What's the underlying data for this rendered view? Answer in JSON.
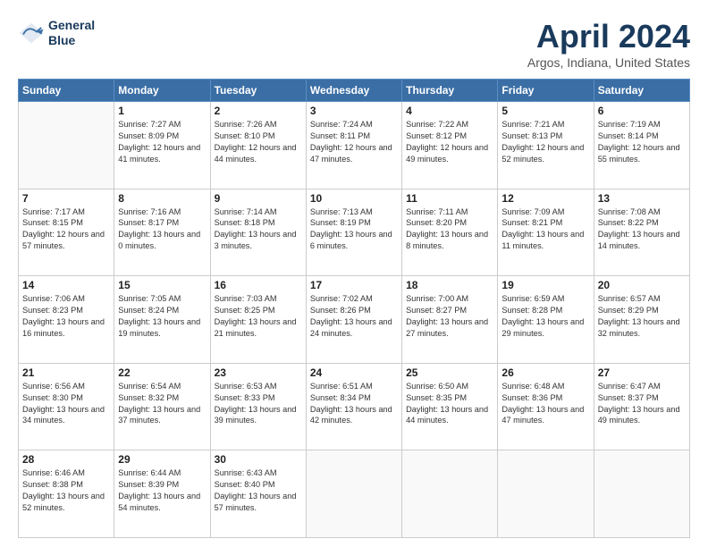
{
  "logo": {
    "line1": "General",
    "line2": "Blue"
  },
  "title": "April 2024",
  "subtitle": "Argos, Indiana, United States",
  "days_of_week": [
    "Sunday",
    "Monday",
    "Tuesday",
    "Wednesday",
    "Thursday",
    "Friday",
    "Saturday"
  ],
  "weeks": [
    [
      null,
      {
        "day": 1,
        "sunrise": "7:27 AM",
        "sunset": "8:09 PM",
        "daylight": "12 hours and 41 minutes."
      },
      {
        "day": 2,
        "sunrise": "7:26 AM",
        "sunset": "8:10 PM",
        "daylight": "12 hours and 44 minutes."
      },
      {
        "day": 3,
        "sunrise": "7:24 AM",
        "sunset": "8:11 PM",
        "daylight": "12 hours and 47 minutes."
      },
      {
        "day": 4,
        "sunrise": "7:22 AM",
        "sunset": "8:12 PM",
        "daylight": "12 hours and 49 minutes."
      },
      {
        "day": 5,
        "sunrise": "7:21 AM",
        "sunset": "8:13 PM",
        "daylight": "12 hours and 52 minutes."
      },
      {
        "day": 6,
        "sunrise": "7:19 AM",
        "sunset": "8:14 PM",
        "daylight": "12 hours and 55 minutes."
      }
    ],
    [
      {
        "day": 7,
        "sunrise": "7:17 AM",
        "sunset": "8:15 PM",
        "daylight": "12 hours and 57 minutes."
      },
      {
        "day": 8,
        "sunrise": "7:16 AM",
        "sunset": "8:17 PM",
        "daylight": "13 hours and 0 minutes."
      },
      {
        "day": 9,
        "sunrise": "7:14 AM",
        "sunset": "8:18 PM",
        "daylight": "13 hours and 3 minutes."
      },
      {
        "day": 10,
        "sunrise": "7:13 AM",
        "sunset": "8:19 PM",
        "daylight": "13 hours and 6 minutes."
      },
      {
        "day": 11,
        "sunrise": "7:11 AM",
        "sunset": "8:20 PM",
        "daylight": "13 hours and 8 minutes."
      },
      {
        "day": 12,
        "sunrise": "7:09 AM",
        "sunset": "8:21 PM",
        "daylight": "13 hours and 11 minutes."
      },
      {
        "day": 13,
        "sunrise": "7:08 AM",
        "sunset": "8:22 PM",
        "daylight": "13 hours and 14 minutes."
      }
    ],
    [
      {
        "day": 14,
        "sunrise": "7:06 AM",
        "sunset": "8:23 PM",
        "daylight": "13 hours and 16 minutes."
      },
      {
        "day": 15,
        "sunrise": "7:05 AM",
        "sunset": "8:24 PM",
        "daylight": "13 hours and 19 minutes."
      },
      {
        "day": 16,
        "sunrise": "7:03 AM",
        "sunset": "8:25 PM",
        "daylight": "13 hours and 21 minutes."
      },
      {
        "day": 17,
        "sunrise": "7:02 AM",
        "sunset": "8:26 PM",
        "daylight": "13 hours and 24 minutes."
      },
      {
        "day": 18,
        "sunrise": "7:00 AM",
        "sunset": "8:27 PM",
        "daylight": "13 hours and 27 minutes."
      },
      {
        "day": 19,
        "sunrise": "6:59 AM",
        "sunset": "8:28 PM",
        "daylight": "13 hours and 29 minutes."
      },
      {
        "day": 20,
        "sunrise": "6:57 AM",
        "sunset": "8:29 PM",
        "daylight": "13 hours and 32 minutes."
      }
    ],
    [
      {
        "day": 21,
        "sunrise": "6:56 AM",
        "sunset": "8:30 PM",
        "daylight": "13 hours and 34 minutes."
      },
      {
        "day": 22,
        "sunrise": "6:54 AM",
        "sunset": "8:32 PM",
        "daylight": "13 hours and 37 minutes."
      },
      {
        "day": 23,
        "sunrise": "6:53 AM",
        "sunset": "8:33 PM",
        "daylight": "13 hours and 39 minutes."
      },
      {
        "day": 24,
        "sunrise": "6:51 AM",
        "sunset": "8:34 PM",
        "daylight": "13 hours and 42 minutes."
      },
      {
        "day": 25,
        "sunrise": "6:50 AM",
        "sunset": "8:35 PM",
        "daylight": "13 hours and 44 minutes."
      },
      {
        "day": 26,
        "sunrise": "6:48 AM",
        "sunset": "8:36 PM",
        "daylight": "13 hours and 47 minutes."
      },
      {
        "day": 27,
        "sunrise": "6:47 AM",
        "sunset": "8:37 PM",
        "daylight": "13 hours and 49 minutes."
      }
    ],
    [
      {
        "day": 28,
        "sunrise": "6:46 AM",
        "sunset": "8:38 PM",
        "daylight": "13 hours and 52 minutes."
      },
      {
        "day": 29,
        "sunrise": "6:44 AM",
        "sunset": "8:39 PM",
        "daylight": "13 hours and 54 minutes."
      },
      {
        "day": 30,
        "sunrise": "6:43 AM",
        "sunset": "8:40 PM",
        "daylight": "13 hours and 57 minutes."
      },
      null,
      null,
      null,
      null
    ]
  ],
  "labels": {
    "sunrise": "Sunrise:",
    "sunset": "Sunset:",
    "daylight": "Daylight:"
  }
}
